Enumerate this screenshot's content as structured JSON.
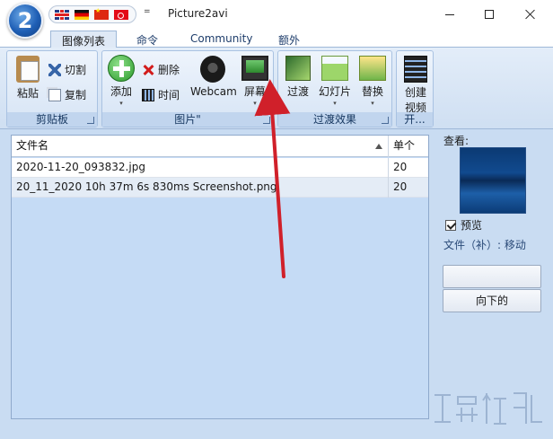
{
  "window": {
    "logo_text": "2",
    "title": "Picture2avi",
    "qat_menu": "="
  },
  "tabs": [
    {
      "label": "图像列表",
      "active": true
    },
    {
      "label": "命令",
      "active": false
    },
    {
      "label": "Community",
      "active": false
    },
    {
      "label": "额外",
      "active": false
    }
  ],
  "ribbon": {
    "clipboard": {
      "label": "剪贴板",
      "paste": "粘贴",
      "cut": "切割",
      "copy": "复制"
    },
    "pictures": {
      "label": "图片\"",
      "add": "添加",
      "delete": "删除",
      "time": "时间",
      "webcam": "Webcam",
      "screen": "屏幕"
    },
    "transitions": {
      "label": "过渡效果",
      "transition": "过渡",
      "slideshow": "幻灯片",
      "replace": "替换"
    },
    "start": {
      "label": "开...",
      "create_video_line1": "创建",
      "create_video_line2": "视频"
    }
  },
  "file_list": {
    "columns": [
      "文件名",
      "单个"
    ],
    "rows": [
      {
        "name": "2020-11-20_093832.jpg",
        "count": "20"
      },
      {
        "name": "20_11_2020 10h 37m 6s 830ms Screenshot.png",
        "count": "20"
      }
    ]
  },
  "side_panel": {
    "view_label": "查看:",
    "preview_label": "预览",
    "preview_checked": true,
    "file_info": "文件（补）: 移动",
    "button_blank": "",
    "button_down": "向下的"
  },
  "colors": {
    "accent": "#1f5fb5",
    "annotation_arrow": "#d0202a",
    "list_bg": "#c5dbf5"
  }
}
